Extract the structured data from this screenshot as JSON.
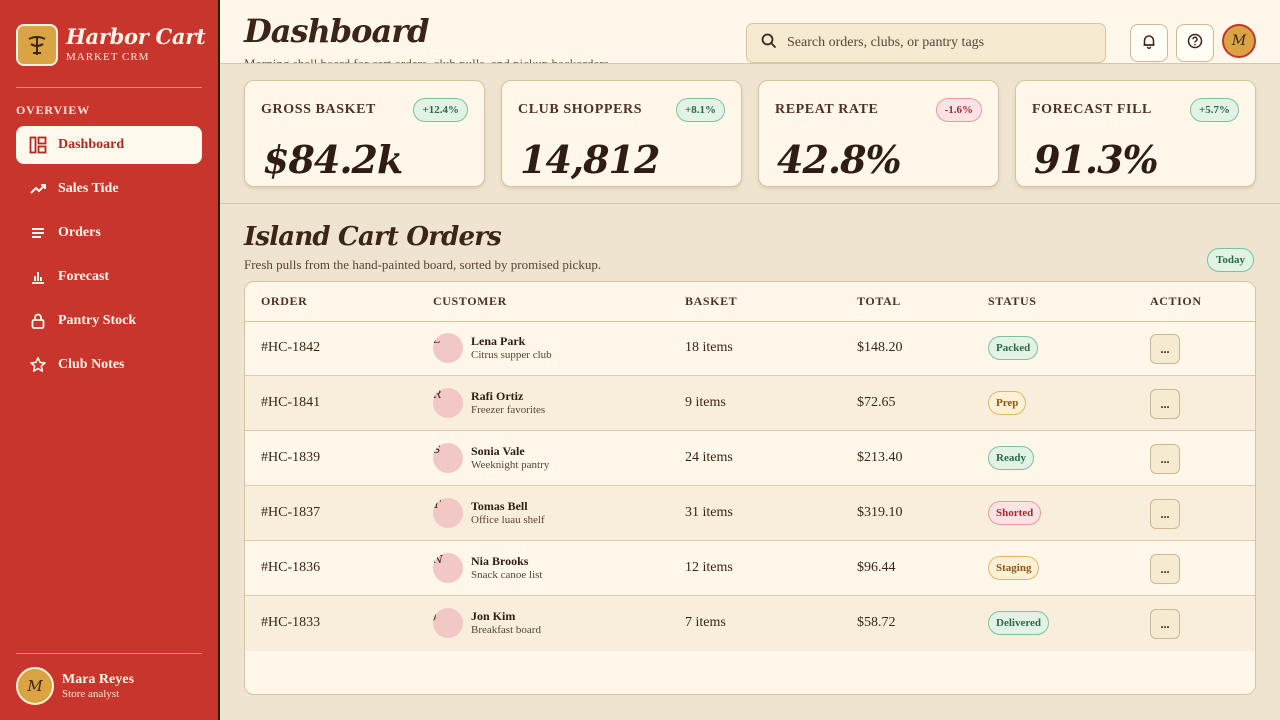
{
  "brand": {
    "name": "Harbor Cart",
    "subtitle": "MARKET CRM",
    "logo_icon": "market-stall-icon"
  },
  "sidebar": {
    "section_label": "OVERVIEW",
    "items": [
      {
        "label": "Dashboard",
        "icon": "dashboard-icon",
        "active": true
      },
      {
        "label": "Sales Tide",
        "icon": "trend-icon"
      },
      {
        "label": "Orders",
        "icon": "list-icon"
      },
      {
        "label": "Forecast",
        "icon": "bar-chart-icon"
      },
      {
        "label": "Pantry Stock",
        "icon": "lock-icon"
      },
      {
        "label": "Club Notes",
        "icon": "star-icon"
      }
    ],
    "user": {
      "initial": "M",
      "name": "Mara Reyes",
      "role": "Store analyst"
    }
  },
  "header": {
    "title": "Dashboard",
    "subtitle": "Morning shell board for cart orders, club pulls, and pickup backorders",
    "search_placeholder": "Search orders, clubs, or pantry tags",
    "avatar_initial": "M"
  },
  "kpis": [
    {
      "label": "GROSS BASKET",
      "value": "$84.2k",
      "delta": "+12.4%",
      "trend": "up"
    },
    {
      "label": "CLUB SHOPPERS",
      "value": "14,812",
      "delta": "+8.1%",
      "trend": "up"
    },
    {
      "label": "REPEAT RATE",
      "value": "42.8%",
      "delta": "-1.6%",
      "trend": "down"
    },
    {
      "label": "FORECAST FILL",
      "value": "91.3%",
      "delta": "+5.7%",
      "trend": "up"
    }
  ],
  "orders": {
    "title": "Island Cart Orders",
    "subtitle": "Fresh pulls from the hand-painted board, sorted by promised pickup.",
    "filter": "Today",
    "columns": [
      "ORDER",
      "CUSTOMER",
      "BASKET",
      "TOTAL",
      "STATUS",
      "ACTION"
    ],
    "rows": [
      {
        "order": "#HC-1842",
        "initial": "L",
        "name": "Lena Park",
        "note": "Citrus supper club",
        "basket": "18 items",
        "total": "$148.20",
        "status": "Packed",
        "tone": "green",
        "action": "..."
      },
      {
        "order": "#HC-1841",
        "initial": "R",
        "name": "Rafi Ortiz",
        "note": "Freezer favorites",
        "basket": "9 items",
        "total": "$72.65",
        "status": "Prep",
        "tone": "gold",
        "action": "..."
      },
      {
        "order": "#HC-1839",
        "initial": "S",
        "name": "Sonia Vale",
        "note": "Weeknight pantry",
        "basket": "24 items",
        "total": "$213.40",
        "status": "Ready",
        "tone": "green",
        "action": "..."
      },
      {
        "order": "#HC-1837",
        "initial": "T",
        "name": "Tomas Bell",
        "note": "Office luau shelf",
        "basket": "31 items",
        "total": "$319.10",
        "status": "Shorted",
        "tone": "red",
        "action": "..."
      },
      {
        "order": "#HC-1836",
        "initial": "N",
        "name": "Nia Brooks",
        "note": "Snack canoe list",
        "basket": "12 items",
        "total": "$96.44",
        "status": "Staging",
        "tone": "gold",
        "action": "..."
      },
      {
        "order": "#HC-1833",
        "initial": "J",
        "name": "Jon Kim",
        "note": "Breakfast board",
        "basket": "7 items",
        "total": "$58.72",
        "status": "Delivered",
        "tone": "green",
        "action": "..."
      }
    ]
  },
  "colors": {
    "sidebar": "#c7352d",
    "accent_gold": "#d9a441",
    "background": "#efe4cf",
    "card": "#fff8ea"
  }
}
